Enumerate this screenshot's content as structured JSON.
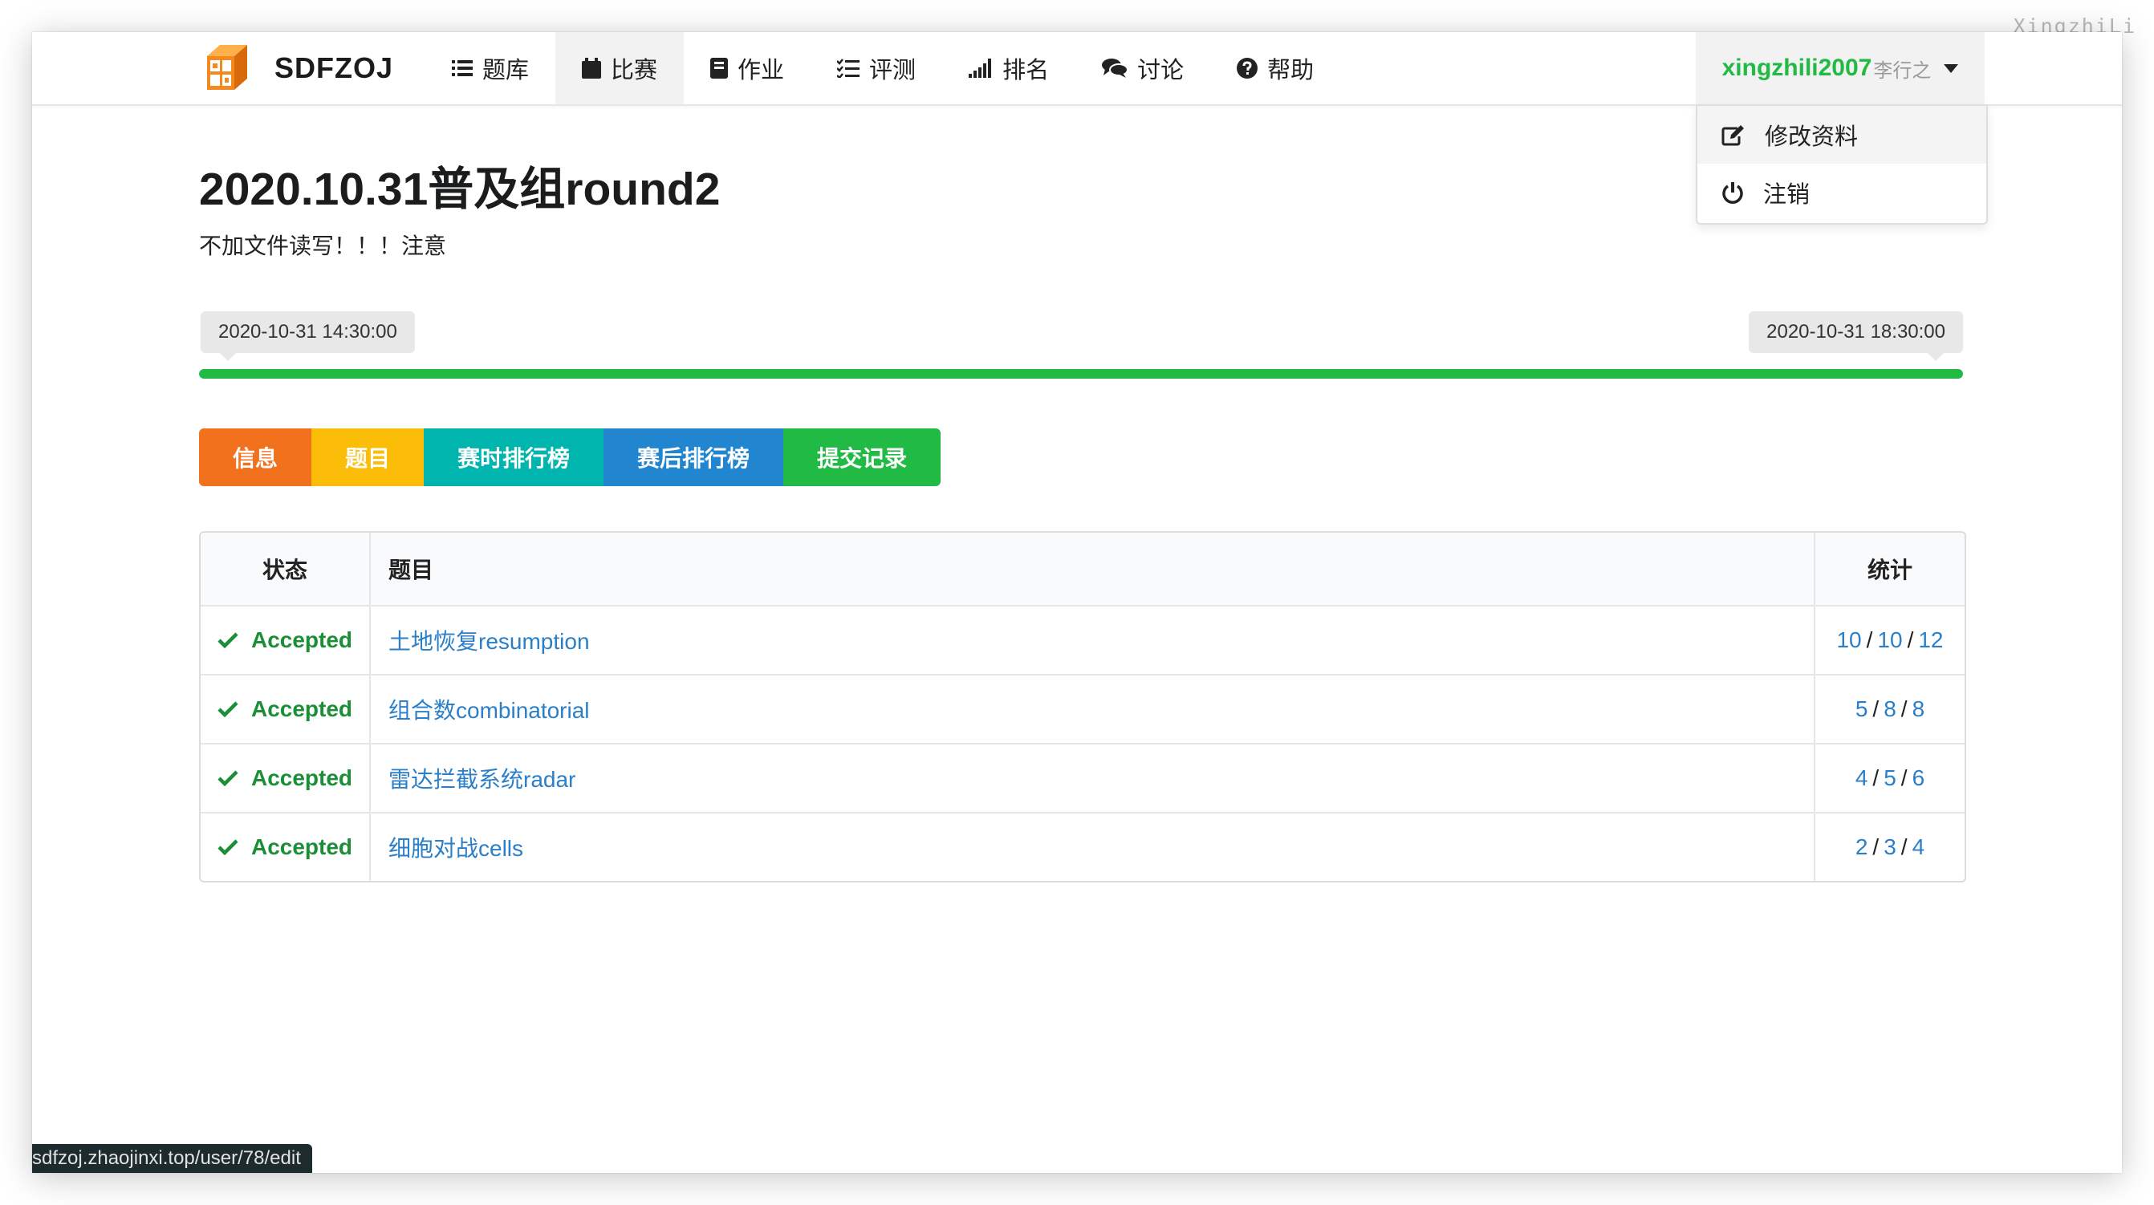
{
  "watermark": "XingzhiLi",
  "nav": {
    "brand": "SDFZOJ",
    "items": [
      {
        "icon": "list-icon",
        "label": "题库"
      },
      {
        "icon": "calendar-icon",
        "label": "比赛"
      },
      {
        "icon": "book-icon",
        "label": "作业"
      },
      {
        "icon": "tasks-icon",
        "label": "评测"
      },
      {
        "icon": "signal-icon",
        "label": "排名"
      },
      {
        "icon": "comments-icon",
        "label": "讨论"
      },
      {
        "icon": "help-icon",
        "label": "帮助"
      }
    ],
    "active_item": "比赛",
    "user": {
      "username": "xingzhili2007",
      "realname": "李行之"
    }
  },
  "dropdown": {
    "items": [
      {
        "icon": "edit-icon",
        "label": "修改资料"
      },
      {
        "icon": "power-icon",
        "label": "注销"
      }
    ]
  },
  "contest": {
    "title": "2020.10.31普及组round2",
    "description": "不加文件读写！！！注意",
    "start_time": "2020-10-31 14:30:00",
    "end_time": "2020-10-31 18:30:00",
    "progress": 1.0
  },
  "tabs": [
    {
      "label": "信息",
      "color": "#f2711c"
    },
    {
      "label": "题目",
      "color": "#fbbd08"
    },
    {
      "label": "赛时排行榜",
      "color": "#00b5ad"
    },
    {
      "label": "赛后排行榜",
      "color": "#2185d0"
    },
    {
      "label": "提交记录",
      "color": "#21ba45"
    }
  ],
  "table": {
    "headers": {
      "status": "状态",
      "title": "题目",
      "stats": "统计"
    },
    "rows": [
      {
        "status": "Accepted",
        "title": "土地恢复resumption",
        "stats": [
          "10",
          "10",
          "12"
        ]
      },
      {
        "status": "Accepted",
        "title": "组合数combinatorial",
        "stats": [
          "5",
          "8",
          "8"
        ]
      },
      {
        "status": "Accepted",
        "title": "雷达拦截系统radar",
        "stats": [
          "4",
          "5",
          "6"
        ]
      },
      {
        "status": "Accepted",
        "title": "细胞对战cells",
        "stats": [
          "2",
          "3",
          "4"
        ]
      }
    ]
  },
  "statusbar": {
    "url": "sdfzoj.zhaojinxi.top/user/78/edit"
  },
  "colors": {
    "accent_green": "#21ba45",
    "link_blue": "#2a7fc8"
  }
}
